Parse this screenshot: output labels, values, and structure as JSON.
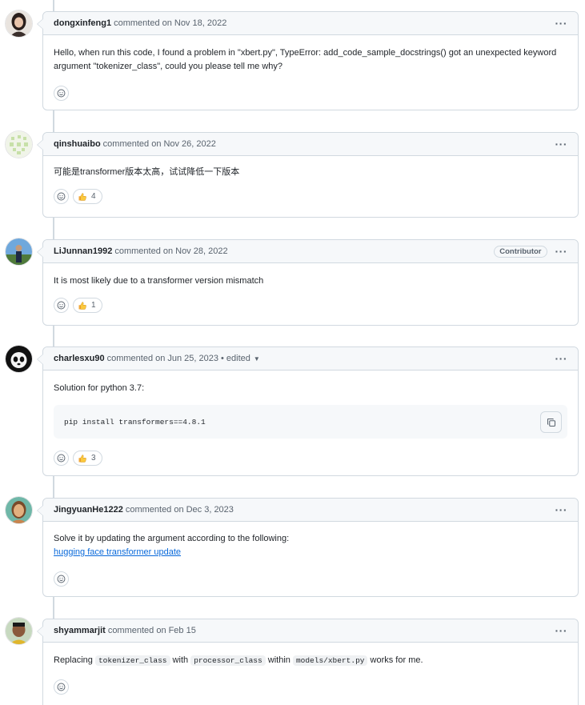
{
  "comments": [
    {
      "author": "dongxinfeng1",
      "action": "commented on",
      "date": "Nov 18, 2022",
      "body": "Hello, when run this code, I found a problem in \"xbert.py\", TypeError: add_code_sample_docstrings() got an unexpected keyword argument \"tokenizer_class\", could you please tell me why?"
    },
    {
      "author": "qinshuaibo",
      "action": "commented on",
      "date": "Nov 26, 2022",
      "body": "可能是transformer版本太高，试试降低一下版本",
      "reaction_count": "4"
    },
    {
      "author": "LiJunnan1992",
      "action": "commented on",
      "date": "Nov 28, 2022",
      "badge": "Contributor",
      "body": "It is most likely due to a transformer version mismatch",
      "reaction_count": "1"
    },
    {
      "author": "charlesxu90",
      "action": "commented on",
      "date": "Jun 25, 2023",
      "edited": "• edited",
      "body": "Solution for python 3.7:",
      "code": "pip install transformers==4.8.1",
      "reaction_count": "3"
    },
    {
      "author": "JingyuanHe1222",
      "action": "commented on",
      "date": "Dec 3, 2023",
      "body": "Solve it by updating the argument according to the following:",
      "link": "hugging face transformer update"
    },
    {
      "author": "shyammarjit",
      "action": "commented on",
      "date": "Feb 15",
      "body_parts": [
        "Replacing ",
        "tokenizer_class",
        " with ",
        "processor_class",
        " within ",
        "models/xbert.py",
        " works for me."
      ]
    }
  ],
  "icons": {
    "menu": "kebab-horizontal-icon",
    "emoji": "smiley-icon",
    "reaction": "thumbs-up-icon",
    "copy": "copy-icon",
    "edited_menu": "triangle-down-icon"
  },
  "colors": {
    "link": "#0969da",
    "border": "#d1d9e0",
    "header_bg": "#f6f8fa",
    "muted": "#59636e"
  }
}
